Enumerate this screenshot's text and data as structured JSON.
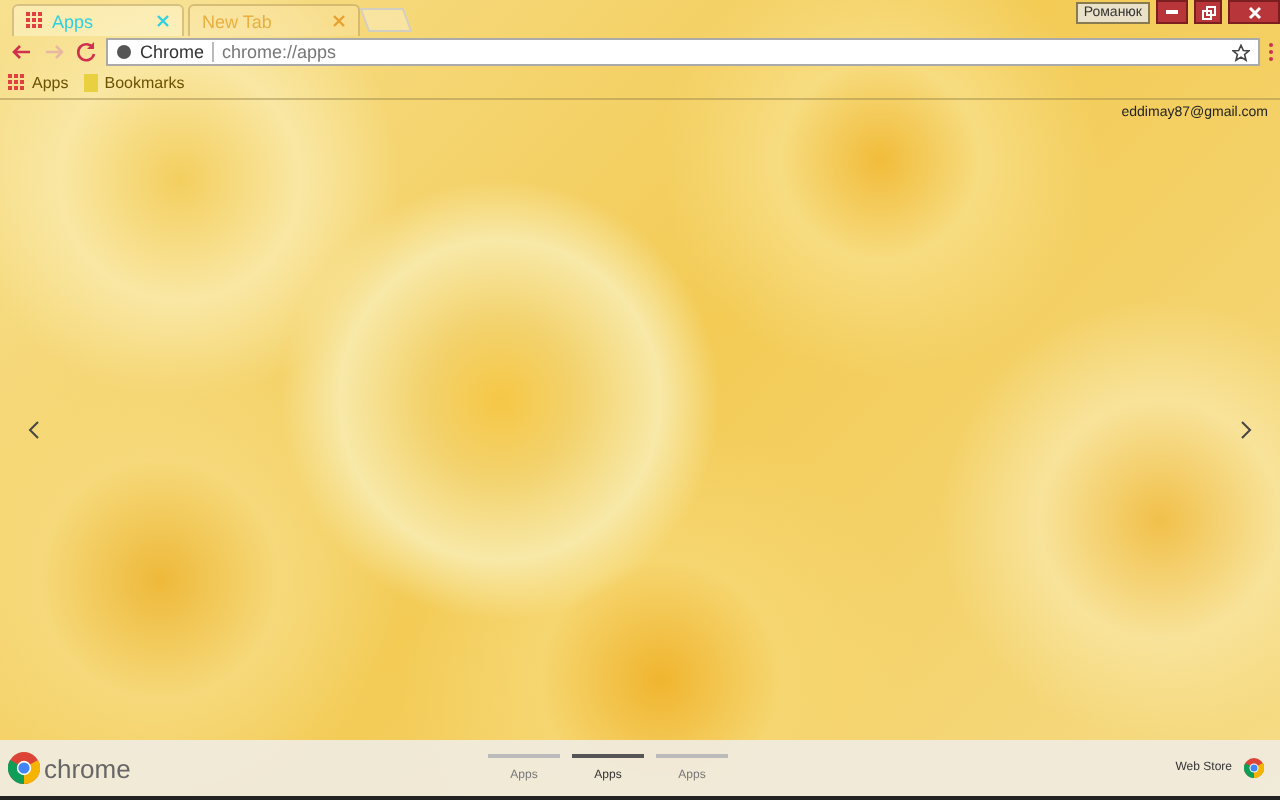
{
  "tabs": [
    {
      "title": "Apps",
      "selected": true
    },
    {
      "title": "New Tab",
      "selected": false
    }
  ],
  "profile": {
    "name": "Романюк"
  },
  "omnibox": {
    "site": "Chrome",
    "url": "chrome://apps"
  },
  "bookmarks": [
    {
      "label": "Apps",
      "kind": "apps"
    },
    {
      "label": "Bookmarks",
      "kind": "folder"
    }
  ],
  "account": {
    "email": "eddimay87@gmail.com"
  },
  "footer": {
    "brand": "chrome",
    "pages": [
      {
        "label": "Apps",
        "selected": false
      },
      {
        "label": "Apps",
        "selected": true
      },
      {
        "label": "Apps",
        "selected": false
      }
    ],
    "store": "Web Store"
  }
}
